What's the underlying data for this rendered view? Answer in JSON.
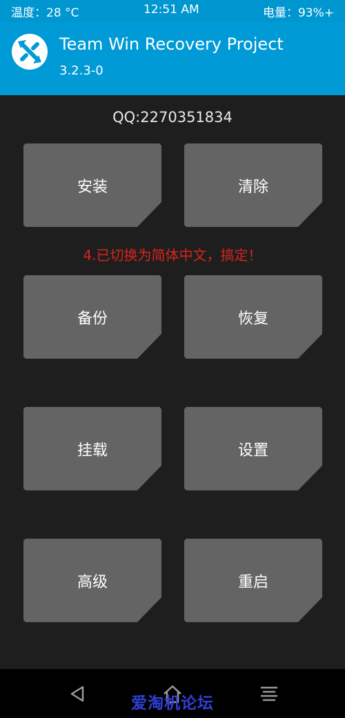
{
  "status_bar": {
    "temperature": "温度：28 °C",
    "time": "12:51 AM",
    "battery": "电量：93%+"
  },
  "header": {
    "title": "Team Win Recovery Project",
    "version": "3.2.3-0",
    "logo_icon": "twrp-logo-icon"
  },
  "main": {
    "qq": "QQ:2270351834",
    "notice": "4.已切换为简体中文，搞定！",
    "buttons": [
      {
        "label": "安装"
      },
      {
        "label": "清除"
      },
      {
        "label": "备份"
      },
      {
        "label": "恢复"
      },
      {
        "label": "挂载"
      },
      {
        "label": "设置"
      },
      {
        "label": "高级"
      },
      {
        "label": "重启"
      }
    ]
  },
  "nav_bar": {
    "icons": [
      "back-icon",
      "home-icon",
      "menu-icon"
    ],
    "watermark": "爱淘机论坛"
  },
  "colors": {
    "header_blue": "#009ad6",
    "tile_gray": "#646464",
    "background": "#1e1e1e",
    "notice_red": "#d9241c",
    "watermark_blue": "#2f3fd6"
  }
}
